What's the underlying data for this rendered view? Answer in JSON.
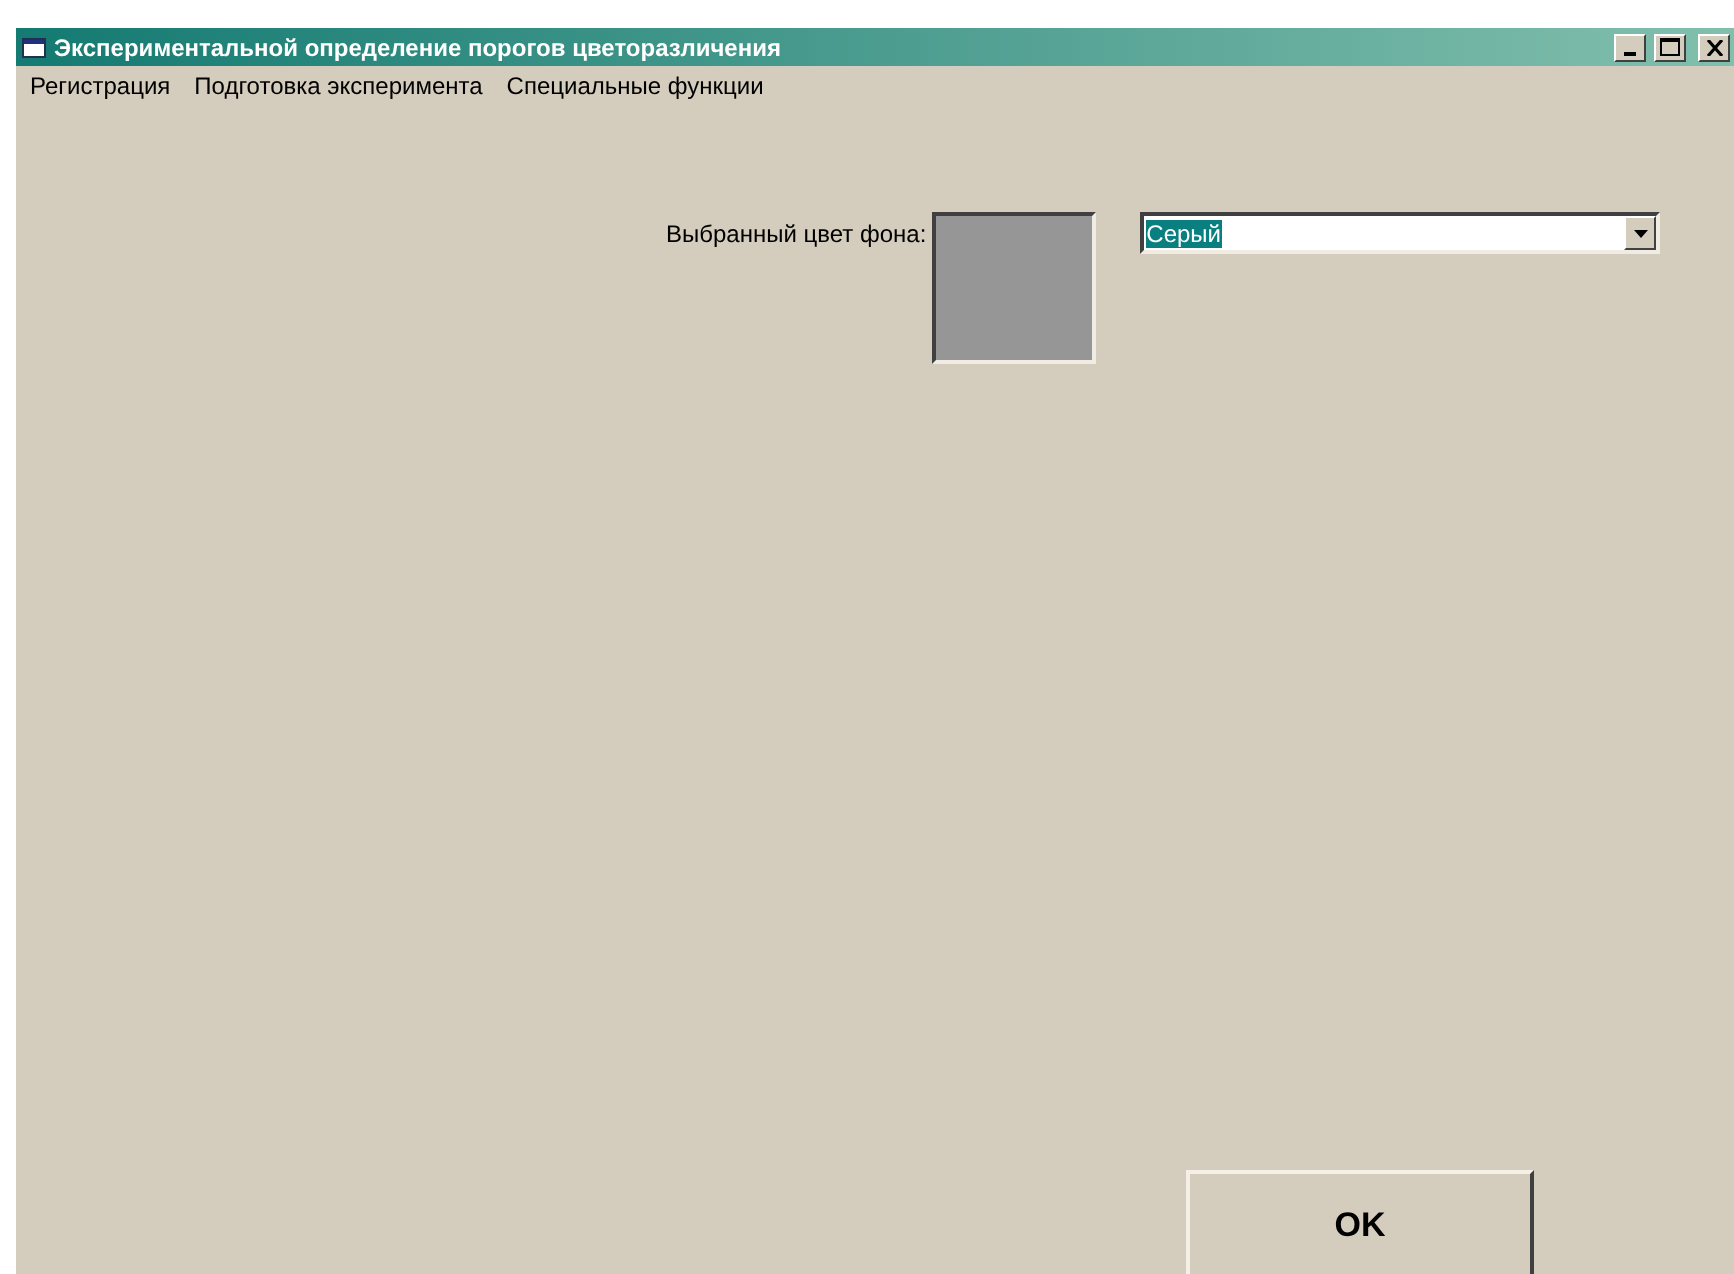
{
  "window": {
    "title": "Экспериментальной определение порогов цветоразличения"
  },
  "menu": [
    {
      "label": "Регистрация"
    },
    {
      "label": "Подготовка эксперимента"
    },
    {
      "label": "Специальные функции"
    }
  ],
  "background": {
    "label": "Выбранный цвет фона:",
    "color": "#969696",
    "value": "Серый"
  },
  "buttons": [
    "OK"
  ]
}
